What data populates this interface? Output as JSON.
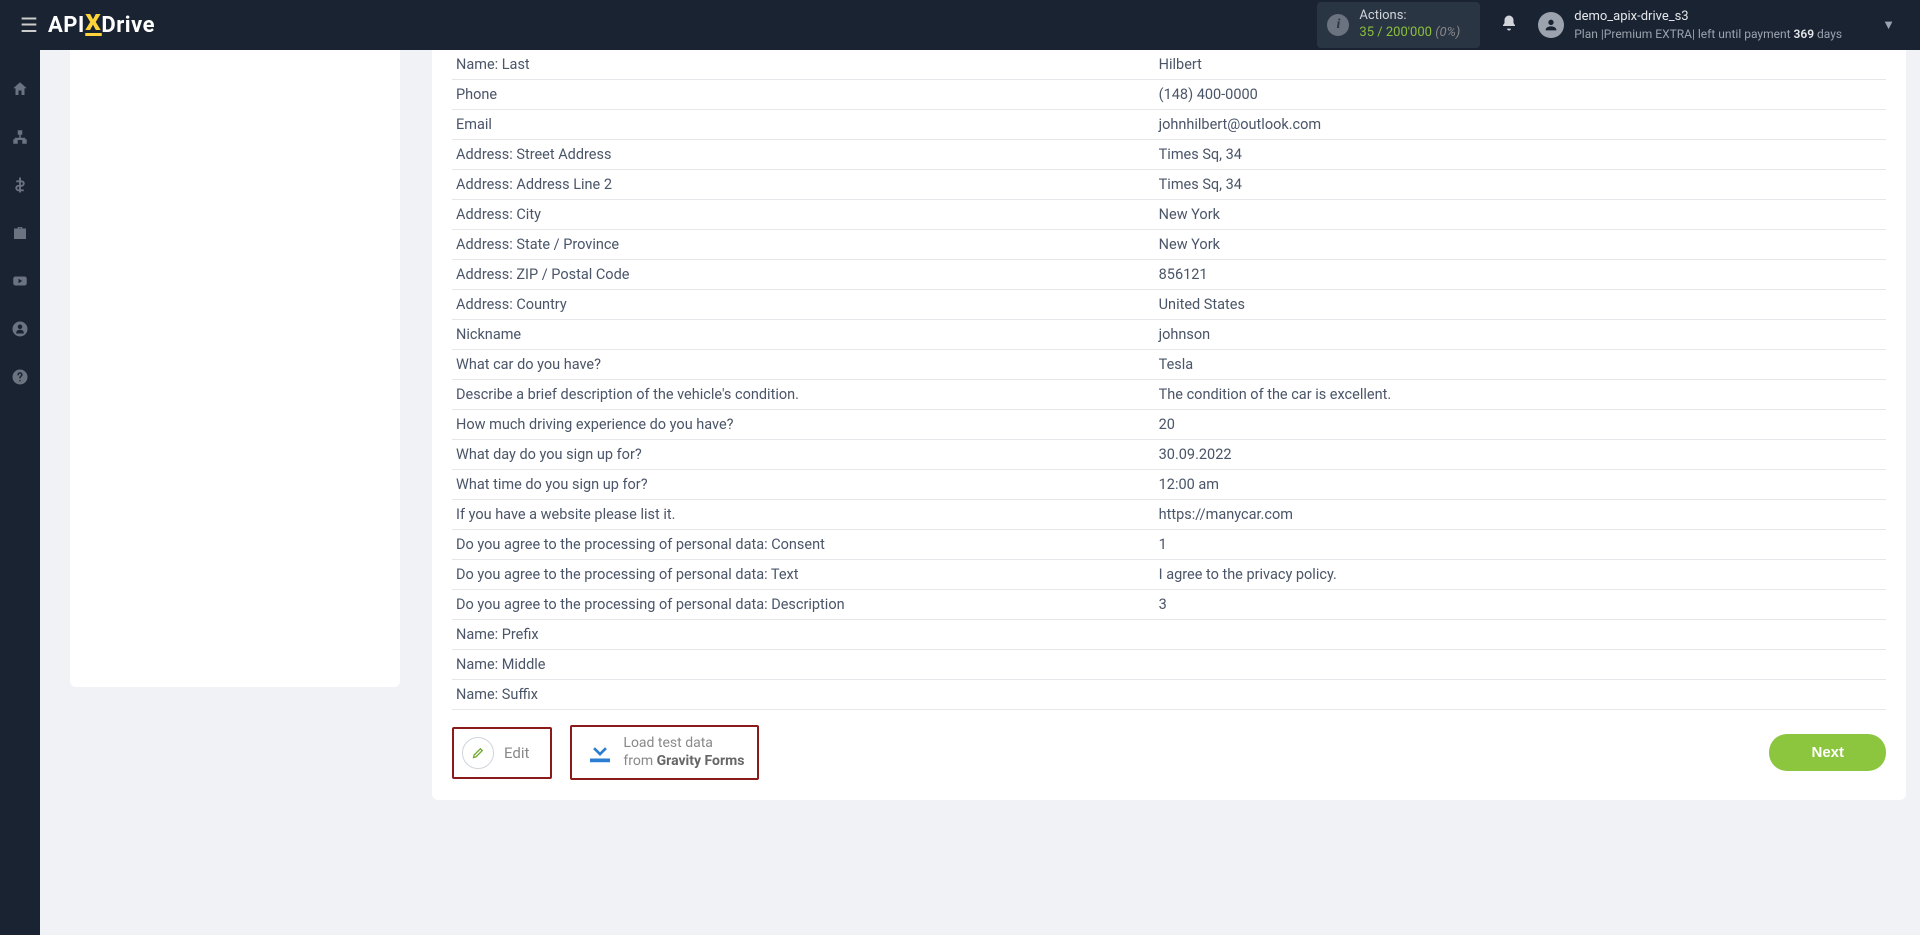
{
  "header": {
    "logo_pre": "API",
    "logo_x": "X",
    "logo_post": "Drive",
    "actions": {
      "label": "Actions:",
      "used": "35",
      "sep": " / ",
      "total": "200'000",
      "pct": "(0%)"
    },
    "user": {
      "name": "demo_apix-drive_s3",
      "plan_prefix": "Plan |",
      "plan_name": "Premium EXTRA",
      "plan_suffix": "| left until payment ",
      "days": "369",
      "days_suffix": " days"
    }
  },
  "data_rows": [
    {
      "label": "Name: Last",
      "value": "Hilbert"
    },
    {
      "label": "Phone",
      "value": "(148) 400-0000"
    },
    {
      "label": "Email",
      "value": "johnhilbert@outlook.com"
    },
    {
      "label": "Address: Street Address",
      "value": "Times Sq, 34"
    },
    {
      "label": "Address: Address Line 2",
      "value": "Times Sq, 34"
    },
    {
      "label": "Address: City",
      "value": "New York"
    },
    {
      "label": "Address: State / Province",
      "value": "New York"
    },
    {
      "label": "Address: ZIP / Postal Code",
      "value": "856121"
    },
    {
      "label": "Address: Country",
      "value": "United States"
    },
    {
      "label": "Nickname",
      "value": "johnson"
    },
    {
      "label": "What car do you have?",
      "value": "Tesla"
    },
    {
      "label": "Describe a brief description of the vehicle's condition.",
      "value": "The condition of the car is excellent."
    },
    {
      "label": "How much driving experience do you have?",
      "value": "20"
    },
    {
      "label": "What day do you sign up for?",
      "value": "30.09.2022"
    },
    {
      "label": "What time do you sign up for?",
      "value": "12:00 am"
    },
    {
      "label": "If you have a website please list it.",
      "value": "https://manycar.com"
    },
    {
      "label": "Do you agree to the processing of personal data: Consent",
      "value": "1"
    },
    {
      "label": "Do you agree to the processing of personal data: Text",
      "value": "I agree to the privacy policy."
    },
    {
      "label": "Do you agree to the processing of personal data: Description",
      "value": "3"
    },
    {
      "label": "Name: Prefix",
      "value": ""
    },
    {
      "label": "Name: Middle",
      "value": ""
    },
    {
      "label": "Name: Suffix",
      "value": ""
    }
  ],
  "buttons": {
    "edit": "Edit",
    "load_line1": "Load test data",
    "load_from": "from ",
    "load_source": "Gravity Forms",
    "next": "Next"
  }
}
